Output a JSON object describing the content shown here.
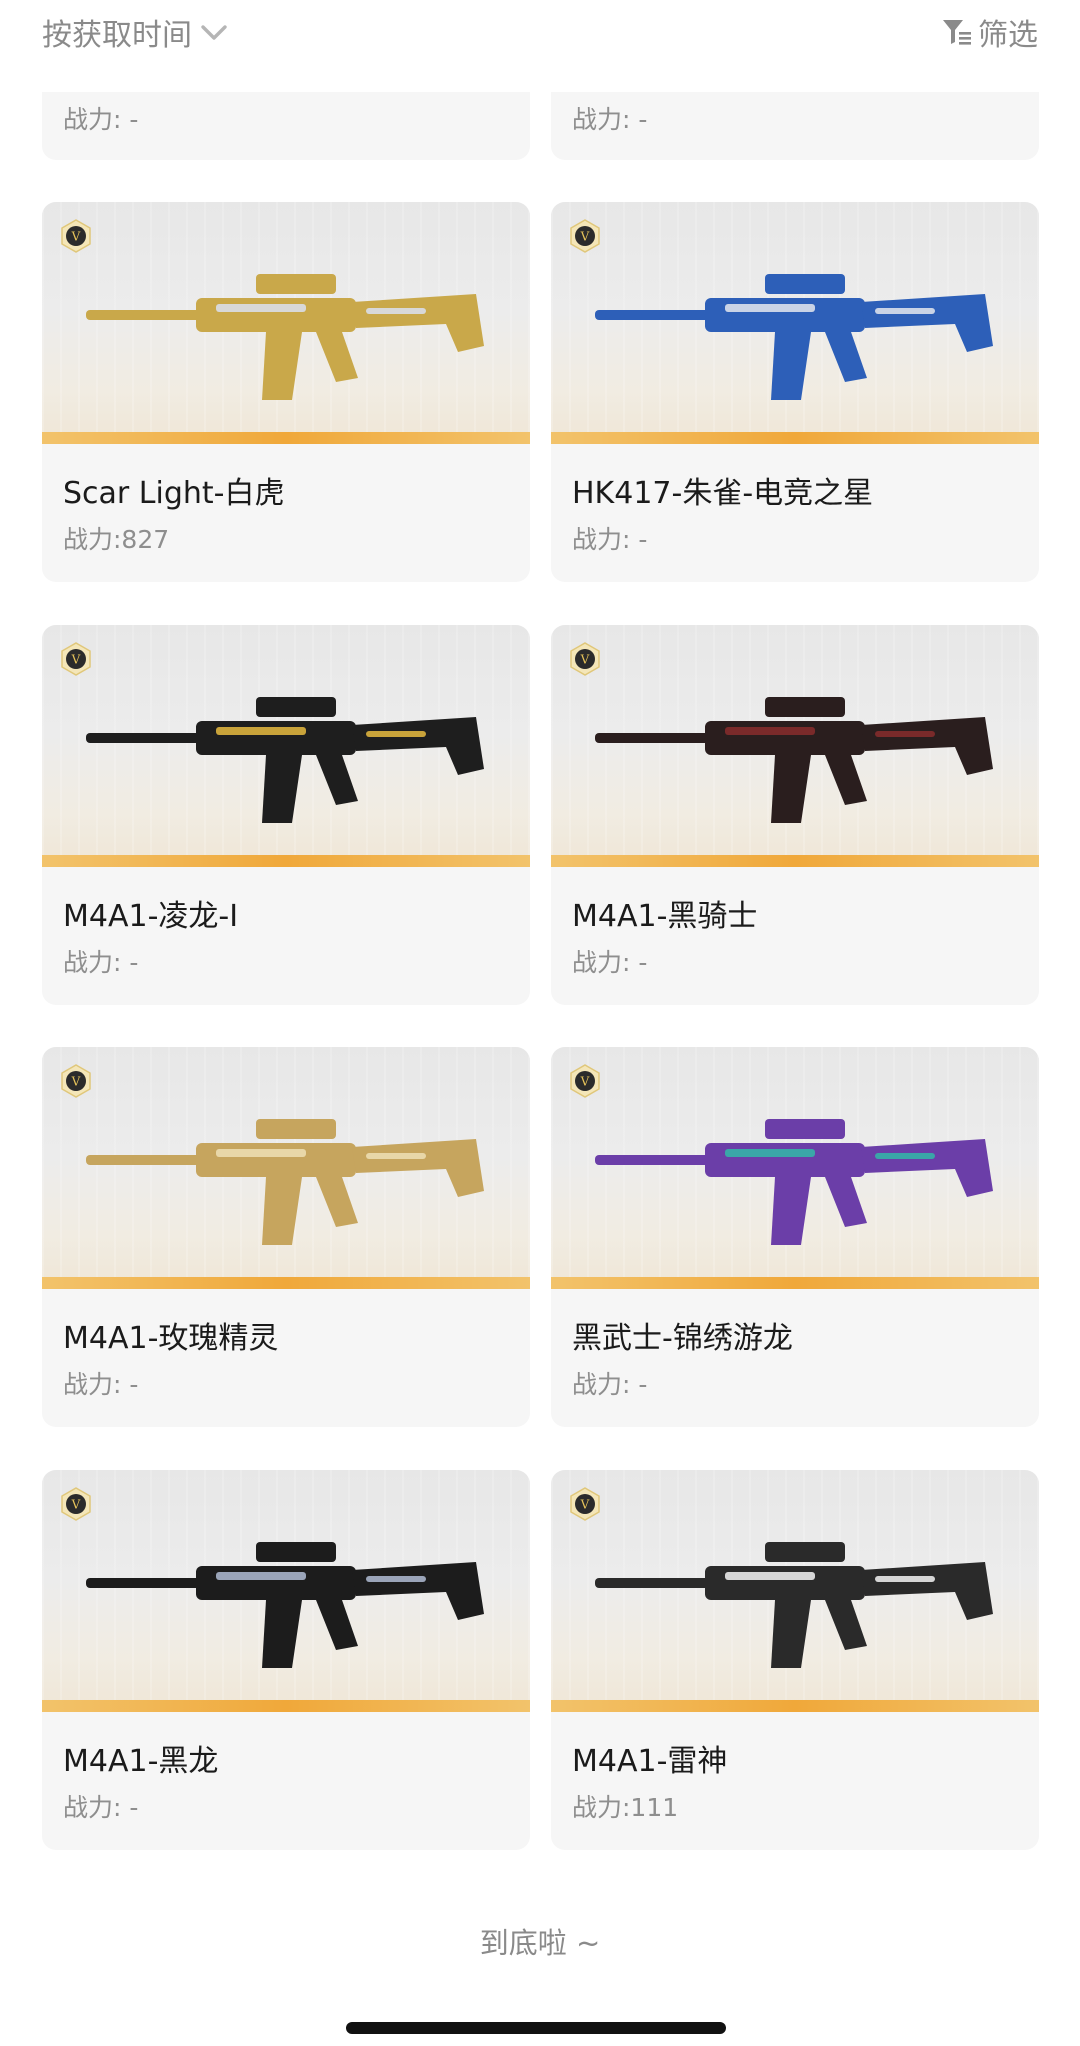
{
  "header": {
    "sort_label": "按获取时间",
    "filter_label": "筛选"
  },
  "partial_row": [
    {
      "power": "战力: -"
    },
    {
      "power": "战力: -"
    }
  ],
  "items": [
    {
      "name": "Scar Light-白虎",
      "power": "战力:827",
      "gun_color": "#c9a84a",
      "gun_accent": "#d8d8d8"
    },
    {
      "name": "HK417-朱雀-电竞之星",
      "power": "战力: -",
      "gun_color": "#2d5fb8",
      "gun_accent": "#c9d3e6"
    },
    {
      "name": "M4A1-凌龙-I",
      "power": "战力: -",
      "gun_color": "#1e1e1e",
      "gun_accent": "#c9a33a"
    },
    {
      "name": "M4A1-黑骑士",
      "power": "战力: -",
      "gun_color": "#2a1e1e",
      "gun_accent": "#7a2a2a"
    },
    {
      "name": "M4A1-玫瑰精灵",
      "power": "战力: -",
      "gun_color": "#c6a55e",
      "gun_accent": "#e8d7a8"
    },
    {
      "name": "黑武士-锦绣游龙",
      "power": "战力: -",
      "gun_color": "#6b3ea8",
      "gun_accent": "#3aa6a8"
    },
    {
      "name": "M4A1-黑龙",
      "power": "战力: -",
      "gun_color": "#1c1c1c",
      "gun_accent": "#9aa4b8"
    },
    {
      "name": "M4A1-雷神",
      "power": "战力:111",
      "gun_color": "#2a2a2a",
      "gun_accent": "#d6d6d6"
    }
  ],
  "footer": {
    "end_text": "到底啦 ~"
  }
}
